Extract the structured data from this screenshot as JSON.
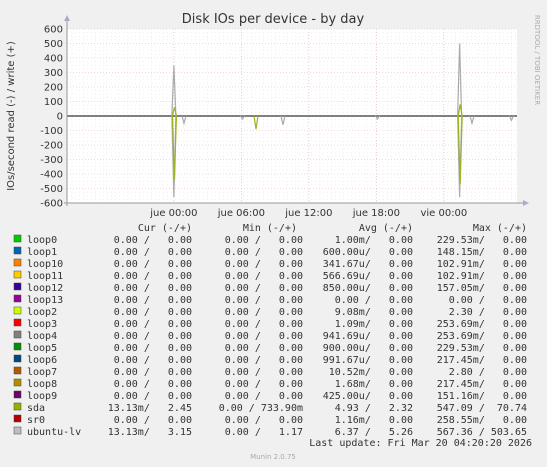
{
  "chart_data": {
    "type": "line",
    "title": "Disk IOs per device - by day",
    "ylabel": "IOs/second read (-) / write (+)",
    "side_text": "RRDTOOL / TOBI OETIKER",
    "yticks": [
      600,
      500,
      400,
      300,
      200,
      100,
      0,
      -100,
      -200,
      -300,
      -400,
      -500,
      -600
    ],
    "ylim": [
      -600,
      600
    ],
    "xticks": [
      {
        "label": "jue 00:00",
        "h": 9
      },
      {
        "label": "jue 06:00",
        "h": 15
      },
      {
        "label": "jue 12:00",
        "h": 21
      },
      {
        "label": "jue 18:00",
        "h": 27
      },
      {
        "label": "vie 00:00",
        "h": 33
      }
    ],
    "xlim_hours": [
      -0.5,
      39.5
    ],
    "spikes": [
      {
        "h": 9.0,
        "up": 350,
        "down": -560,
        "upcolor": "#aaaaaa",
        "downcolor": "#aaaaaa"
      },
      {
        "h": 9.05,
        "up": 60,
        "down": -440,
        "upcolor": "#98b41f",
        "downcolor": "#98b41f"
      },
      {
        "h": 9.9,
        "up": 0,
        "down": -50,
        "upcolor": "#aaaaaa",
        "downcolor": "#aaaaaa"
      },
      {
        "h": 16.3,
        "up": 0,
        "down": -90,
        "upcolor": "#aaaaaa",
        "downcolor": "#98b41f"
      },
      {
        "h": 15.1,
        "up": 0,
        "down": -20,
        "upcolor": "#aaaaaa",
        "downcolor": "#aaaaaa"
      },
      {
        "h": 18.7,
        "up": 0,
        "down": -60,
        "upcolor": "#aaaaaa",
        "downcolor": "#aaaaaa"
      },
      {
        "h": 27.1,
        "up": 0,
        "down": -20,
        "upcolor": "#aaaaaa",
        "downcolor": "#aaaaaa"
      },
      {
        "h": 34.4,
        "up": 500,
        "down": -560,
        "upcolor": "#aaaaaa",
        "downcolor": "#aaaaaa"
      },
      {
        "h": 34.45,
        "up": 80,
        "down": -470,
        "upcolor": "#98b41f",
        "downcolor": "#98b41f"
      },
      {
        "h": 35.5,
        "up": 0,
        "down": -50,
        "upcolor": "#aaaaaa",
        "downcolor": "#aaaaaa"
      },
      {
        "h": 39.0,
        "up": 0,
        "down": -30,
        "upcolor": "#aaaaaa",
        "downcolor": "#aaaaaa"
      }
    ],
    "series": [
      {
        "name": "loop0",
        "color": "#00cc00",
        "cur": "0.00 /   0.00",
        "min": "0.00 /   0.00",
        "avg": "1.00m/   0.00",
        "max": "229.53m/   0.00"
      },
      {
        "name": "loop1",
        "color": "#0066b3",
        "cur": "0.00 /   0.00",
        "min": "0.00 /   0.00",
        "avg": "600.00u/   0.00",
        "max": "148.15m/   0.00"
      },
      {
        "name": "loop10",
        "color": "#ff8000",
        "cur": "0.00 /   0.00",
        "min": "0.00 /   0.00",
        "avg": "341.67u/   0.00",
        "max": "102.91m/   0.00"
      },
      {
        "name": "loop11",
        "color": "#ffcc00",
        "cur": "0.00 /   0.00",
        "min": "0.00 /   0.00",
        "avg": "566.69u/   0.00",
        "max": "102.91m/   0.00"
      },
      {
        "name": "loop12",
        "color": "#330099",
        "cur": "0.00 /   0.00",
        "min": "0.00 /   0.00",
        "avg": "850.00u/   0.00",
        "max": "157.05m/   0.00"
      },
      {
        "name": "loop13",
        "color": "#990099",
        "cur": "0.00 /   0.00",
        "min": "0.00 /   0.00",
        "avg": "0.00 /   0.00",
        "max": "0.00 /   0.00"
      },
      {
        "name": "loop2",
        "color": "#ccff00",
        "cur": "0.00 /   0.00",
        "min": "0.00 /   0.00",
        "avg": "9.08m/   0.00",
        "max": "2.30 /   0.00"
      },
      {
        "name": "loop3",
        "color": "#ff0000",
        "cur": "0.00 /   0.00",
        "min": "0.00 /   0.00",
        "avg": "1.09m/   0.00",
        "max": "253.69m/   0.00"
      },
      {
        "name": "loop4",
        "color": "#808080",
        "cur": "0.00 /   0.00",
        "min": "0.00 /   0.00",
        "avg": "941.69u/   0.00",
        "max": "253.69m/   0.00"
      },
      {
        "name": "loop5",
        "color": "#008f00",
        "cur": "0.00 /   0.00",
        "min": "0.00 /   0.00",
        "avg": "900.00u/   0.00",
        "max": "229.53m/   0.00"
      },
      {
        "name": "loop6",
        "color": "#00487d",
        "cur": "0.00 /   0.00",
        "min": "0.00 /   0.00",
        "avg": "991.67u/   0.00",
        "max": "217.45m/   0.00"
      },
      {
        "name": "loop7",
        "color": "#b35a00",
        "cur": "0.00 /   0.00",
        "min": "0.00 /   0.00",
        "avg": "10.52m/   0.00",
        "max": "2.80 /   0.00"
      },
      {
        "name": "loop8",
        "color": "#b38f00",
        "cur": "0.00 /   0.00",
        "min": "0.00 /   0.00",
        "avg": "1.68m/   0.00",
        "max": "217.45m/   0.00"
      },
      {
        "name": "loop9",
        "color": "#6b006b",
        "cur": "0.00 /   0.00",
        "min": "0.00 /   0.00",
        "avg": "425.00u/   0.00",
        "max": "151.16m/   0.00"
      },
      {
        "name": "sda",
        "color": "#8fb300",
        "cur": "13.13m/   2.45",
        "min": "0.00 / 733.90m",
        "avg": "4.93 /   2.32",
        "max": "547.09 /  70.74"
      },
      {
        "name": "sr0",
        "color": "#b30000",
        "cur": "0.00 /   0.00",
        "min": "0.00 /   0.00",
        "avg": "1.16m/   0.00",
        "max": "258.55m/   0.00"
      },
      {
        "name": "ubuntu-lv",
        "color": "#bebebe",
        "cur": "13.13m/   3.15",
        "min": "0.00 /   1.17",
        "avg": "6.37 /   5.26",
        "max": "567.36 / 503.65"
      }
    ]
  },
  "legend_headers": {
    "cur": "Cur (-/+)",
    "min": "Min (-/+)",
    "avg": "Avg (-/+)",
    "max": "Max (-/+)"
  },
  "last_update": "Last update: Fri Mar 20 04:20:20 2026",
  "footer": "Munin 2.0.75"
}
